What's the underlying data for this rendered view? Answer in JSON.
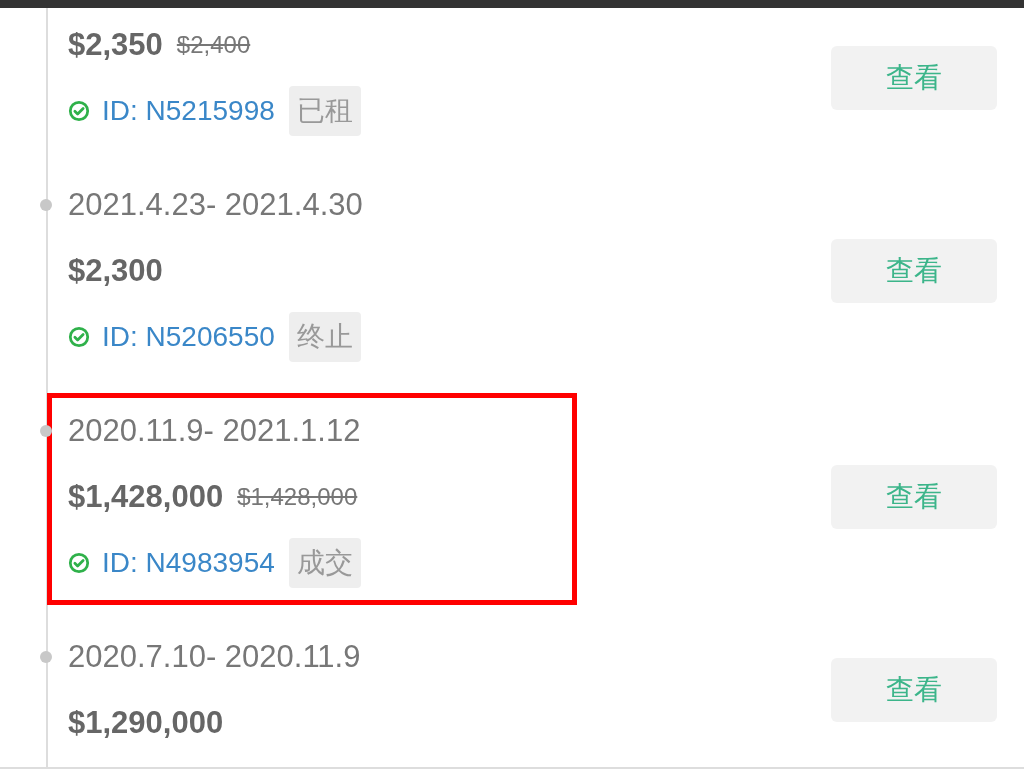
{
  "entries": [
    {
      "price": "$2,350",
      "original_price": "$2,400",
      "id": "ID: N5215998",
      "status": "已租",
      "button": "查看",
      "highlighted": false
    },
    {
      "date": "2021.4.23- 2021.4.30",
      "price": "$2,300",
      "id": "ID: N5206550",
      "status": "终止",
      "button": "查看",
      "highlighted": false
    },
    {
      "date": "2020.11.9- 2021.1.12",
      "price": "$1,428,000",
      "original_price": "$1,428,000",
      "id": "ID: N4983954",
      "status": "成交",
      "button": "查看",
      "highlighted": true
    },
    {
      "date": "2020.7.10- 2020.11.9",
      "price": "$1,290,000",
      "button": "查看",
      "highlighted": false
    }
  ]
}
